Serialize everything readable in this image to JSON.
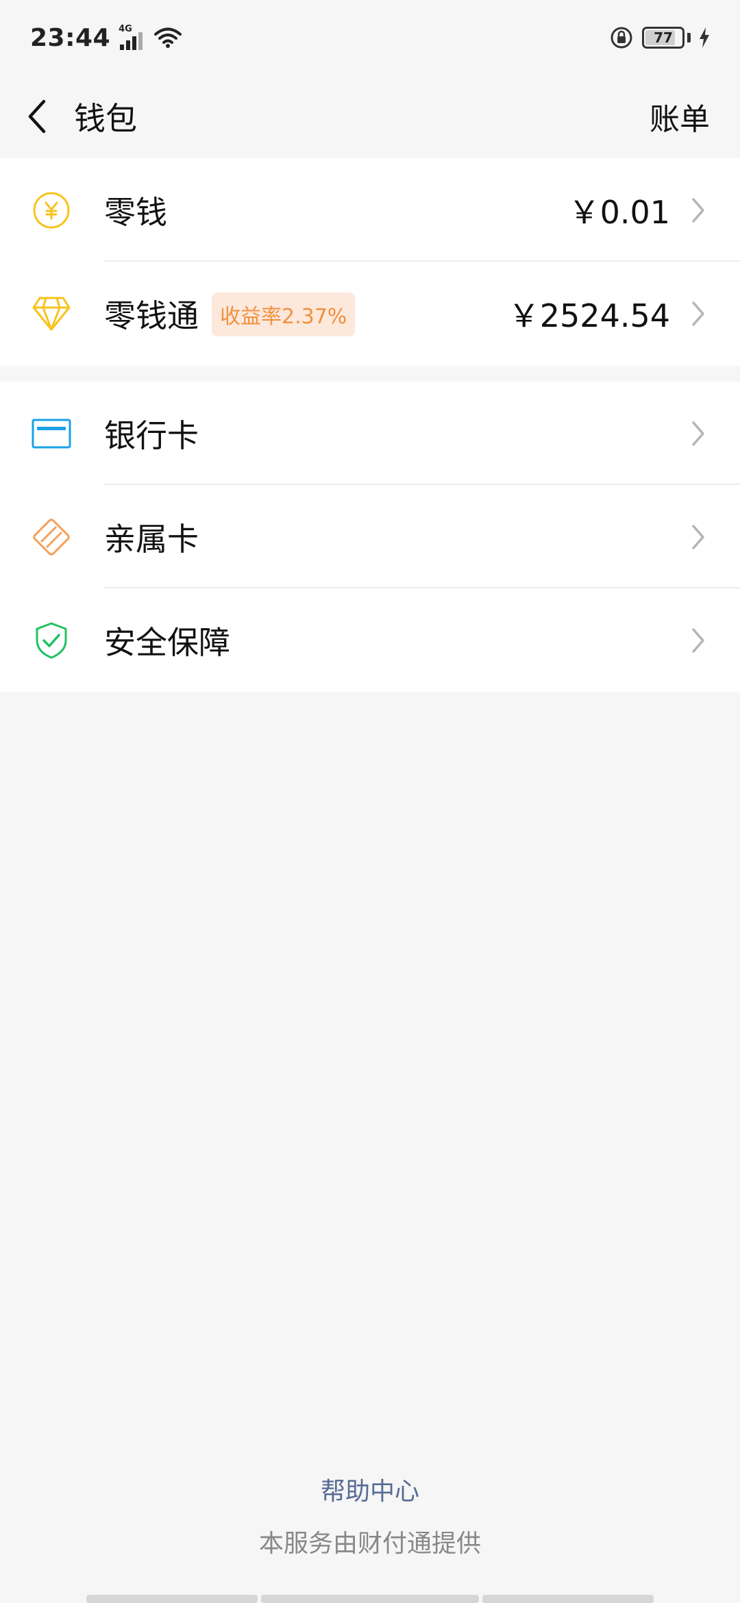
{
  "status_bar": {
    "time": "23:44",
    "network": "4G",
    "battery": "77",
    "icons": [
      "signal-icon",
      "wifi-icon",
      "rotation-lock-icon",
      "battery-icon",
      "charging-icon"
    ]
  },
  "nav": {
    "title": "钱包",
    "action": "账单",
    "back_icon": "back-arrow-icon"
  },
  "groups": [
    {
      "items": [
        {
          "label": "零钱",
          "value": "￥0.01",
          "icon": "yuan-coin-icon",
          "icon_color": "#f7c31b"
        },
        {
          "label": "零钱通",
          "badge": "收益率2.37%",
          "value": "￥2524.54",
          "icon": "diamond-icon",
          "icon_color": "#f7c31b"
        }
      ]
    },
    {
      "items": [
        {
          "label": "银行卡",
          "icon": "bank-card-icon",
          "icon_color": "#1aa1e8"
        },
        {
          "label": "亲属卡",
          "icon": "family-card-icon",
          "icon_color": "#f5a05a"
        },
        {
          "label": "安全保障",
          "icon": "shield-check-icon",
          "icon_color": "#20c161"
        }
      ]
    }
  ],
  "footer": {
    "help": "帮助中心",
    "provider": "本服务由财付通提供"
  },
  "colors": {
    "background": "#f6f6f6",
    "link": "#576b95",
    "badge_text": "#f0913d",
    "badge_bg": "#fde8dc"
  }
}
